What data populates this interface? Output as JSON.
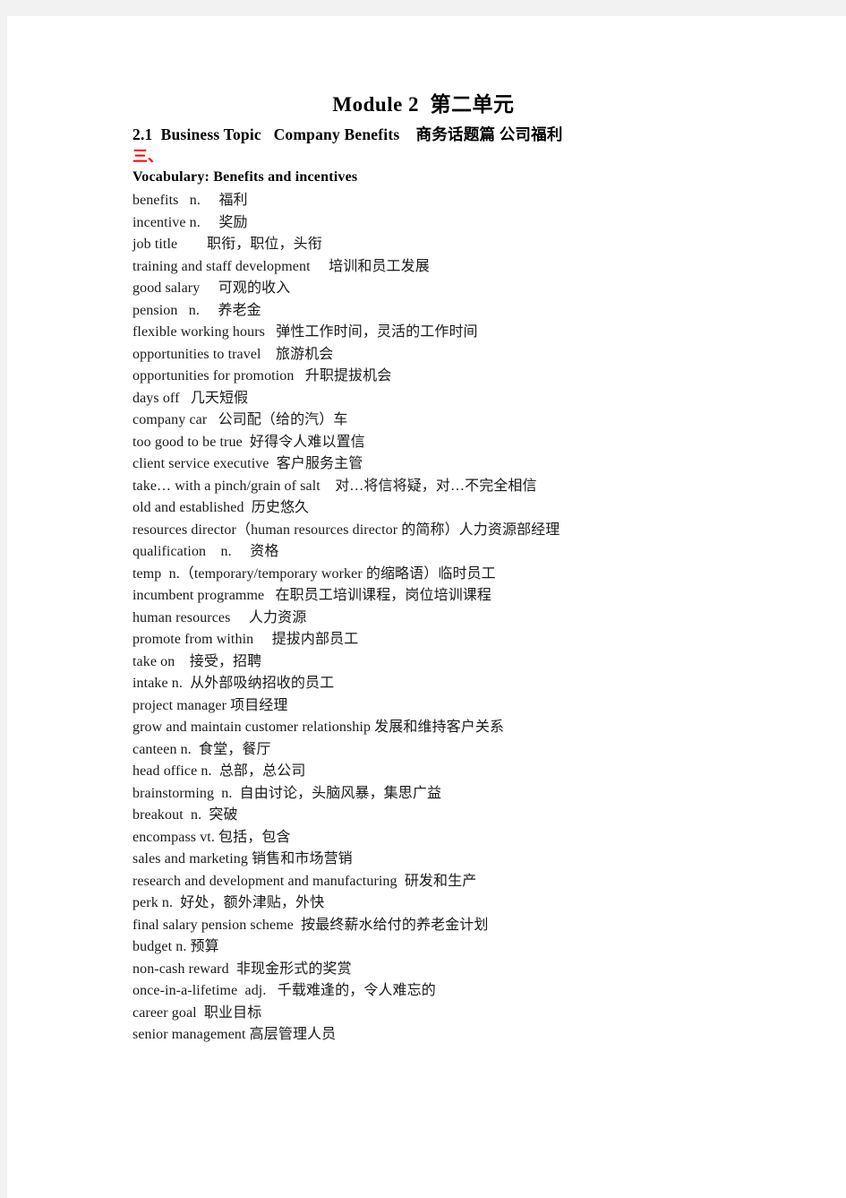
{
  "document": {
    "title": "Module 2  第二单元",
    "subtitle": "2.1  Business Topic   Company Benefits    商务话题篇 公司福利",
    "section_marker": "三、",
    "section_marker_color": "#ff0000",
    "vocabulary_heading": "Vocabulary: Benefits and incentives",
    "entries": [
      "benefits   n.     福利",
      "incentive n.     奖励",
      "job title        职衔，职位，头衔",
      "training and staff development     培训和员工发展",
      "good salary     可观的收入",
      "pension   n.     养老金",
      "flexible working hours   弹性工作时间，灵活的工作时间",
      "opportunities to travel    旅游机会",
      "opportunities for promotion   升职提拔机会",
      "days off   几天短假",
      "company car   公司配（给的汽）车",
      "too good to be true  好得令人难以置信",
      "client service executive  客户服务主管",
      "take… with a pinch/grain of salt    对…将信将疑，对…不完全相信",
      "old and established  历史悠久",
      "resources director（human resources director 的简称）人力资源部经理",
      "qualification    n.     资格",
      "temp  n.（temporary/temporary worker 的缩略语）临时员工",
      "incumbent programme   在职员工培训课程，岗位培训课程",
      "human resources     人力资源",
      "promote from within     提拔内部员工",
      "take on    接受，招聘",
      "intake n.  从外部吸纳招收的员工",
      "project manager 项目经理",
      "grow and maintain customer relationship 发展和维持客户关系",
      "canteen n.  食堂，餐厅",
      "head office n.  总部，总公司",
      "brainstorming  n.  自由讨论，头脑风暴，集思广益",
      "breakout  n.  突破",
      "encompass vt. 包括，包含",
      "sales and marketing 销售和市场营销",
      "research and development and manufacturing  研发和生产",
      "perk n.  好处，额外津贴，外快",
      "final salary pension scheme  按最终薪水给付的养老金计划",
      "budget n. 预算",
      "non-cash reward  非现金形式的奖赏",
      "once-in-a-lifetime  adj.   千载难逢的，令人难忘的",
      "career goal  职业目标",
      "senior management 高层管理人员"
    ]
  }
}
